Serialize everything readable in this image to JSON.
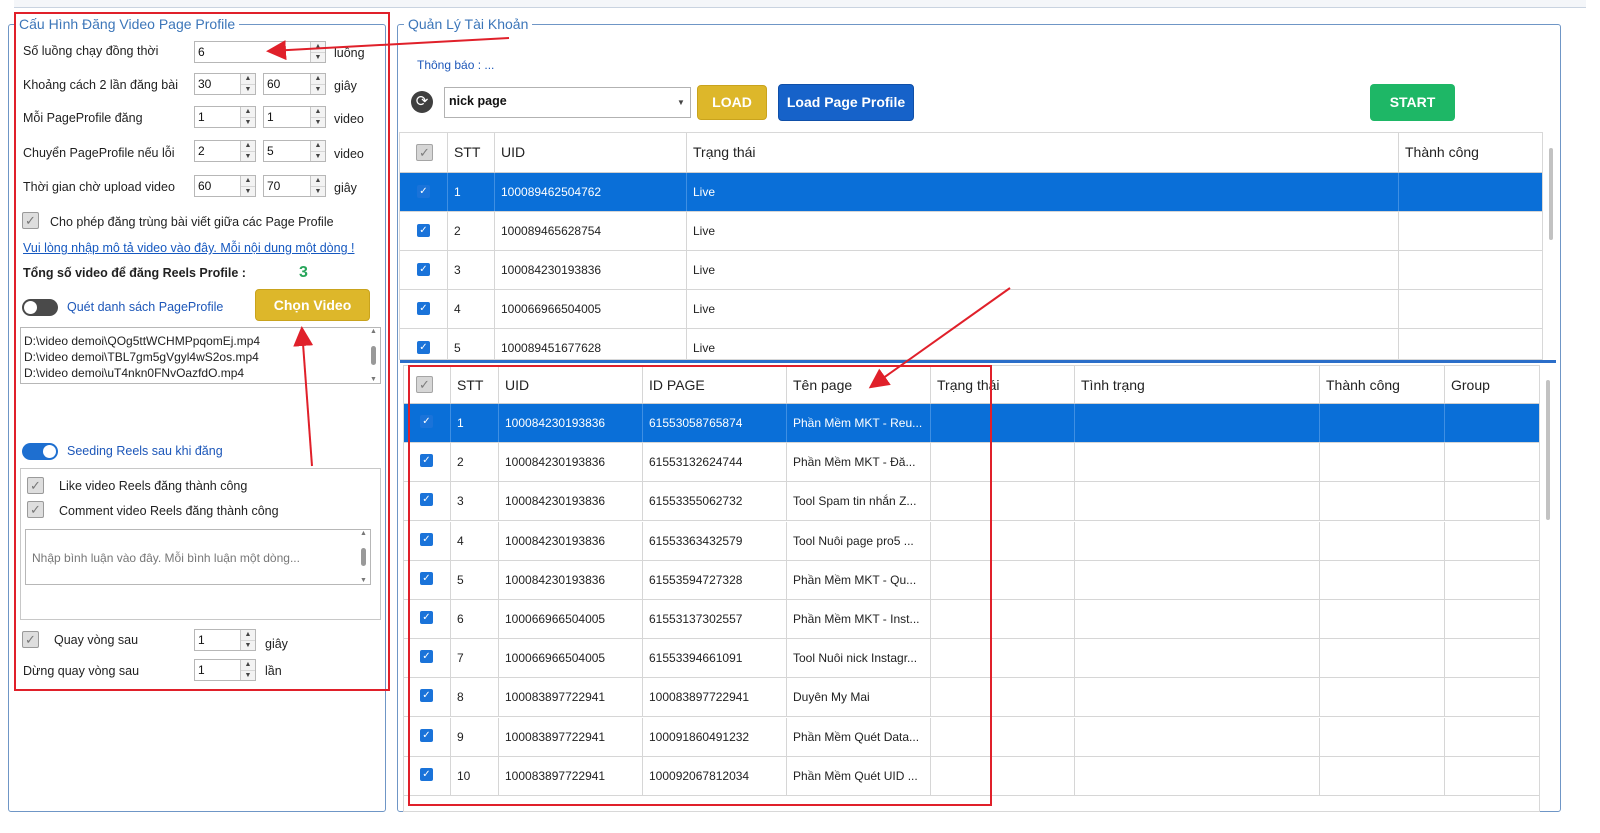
{
  "config": {
    "title": "Cấu Hình Đăng Video Page Profile",
    "threads": {
      "label": "Số luồng chạy đồng thời",
      "value": "6",
      "unit": "luồng"
    },
    "post_gap": {
      "label": "Khoảng cách 2 lần đăng bài",
      "min": "30",
      "max": "60",
      "unit": "giây"
    },
    "per_profile": {
      "label": "Mỗi PageProfile đăng",
      "min": "1",
      "max": "1",
      "unit": "video"
    },
    "switch_on_error": {
      "label": "Chuyển PageProfile nếu lỗi",
      "min": "2",
      "max": "5",
      "unit": "video"
    },
    "upload_wait": {
      "label": "Thời gian chờ upload video",
      "min": "60",
      "max": "70",
      "unit": "giây"
    },
    "allow_duplicate_label": "Cho phép đăng trùng bài viết giữa các Page Profile",
    "description_link": "Vui lòng nhập mô tả video vào đây. Mỗi nội dung một dòng !",
    "total_label": "Tổng số video để đăng Reels Profile :",
    "total_count": "3",
    "scan_toggle_label": "Quét danh sách PageProfile",
    "choose_video_button": "Chọn Video",
    "video_files": [
      "D:\\video demoi\\QOg5ttWCHMPpqomEj.mp4",
      "D:\\video demoi\\TBL7gm5gVgyl4wS2os.mp4",
      "D:\\video demoi\\uT4nkn0FNvOazfdO.mp4"
    ],
    "seeding_toggle_label": "Seeding Reels sau khi đăng",
    "like_label": "Like video Reels đăng thành công",
    "comment_label": "Comment video Reels đăng thành công",
    "comment_placeholder": "Nhập bình luận vào đây. Mỗi bình luận một dòng...",
    "loop_after": {
      "label": "Quay vòng sau",
      "value": "1",
      "unit": "giây"
    },
    "stop_loop_after": {
      "label": "Dừng quay vòng sau",
      "value": "1",
      "unit": "lần"
    }
  },
  "account": {
    "title": "Quản Lý Tài Khoản",
    "notice": "Thông báo : ...",
    "combo_value": "nick page",
    "load_button": "LOAD",
    "load_page_button": "Load Page Profile",
    "start_button": "START"
  },
  "accounts_table": {
    "headers": [
      "STT",
      "UID",
      "Trạng thái",
      "Thành công"
    ],
    "rows": [
      {
        "stt": "1",
        "uid": "100089462504762",
        "status": "Live",
        "success": ""
      },
      {
        "stt": "2",
        "uid": "100089465628754",
        "status": "Live",
        "success": ""
      },
      {
        "stt": "3",
        "uid": "100084230193836",
        "status": "Live",
        "success": ""
      },
      {
        "stt": "4",
        "uid": "100066966504005",
        "status": "Live",
        "success": ""
      },
      {
        "stt": "5",
        "uid": "100089451677628",
        "status": "Live",
        "success": ""
      }
    ]
  },
  "pages_table": {
    "headers": [
      "STT",
      "UID",
      "ID PAGE",
      "Tên page",
      "Trạng thái",
      "Tình trạng",
      "Thành công",
      "Group"
    ],
    "rows": [
      {
        "stt": "1",
        "uid": "100084230193836",
        "page_id": "61553058765874",
        "name": "Phần Mềm MKT - Reu..."
      },
      {
        "stt": "2",
        "uid": "100084230193836",
        "page_id": "61553132624744",
        "name": "Phần Mềm MKT - Đă..."
      },
      {
        "stt": "3",
        "uid": "100084230193836",
        "page_id": "61553355062732",
        "name": "Tool Spam tin nhắn Z..."
      },
      {
        "stt": "4",
        "uid": "100084230193836",
        "page_id": "61553363432579",
        "name": "Tool Nuôi page pro5 ..."
      },
      {
        "stt": "5",
        "uid": "100084230193836",
        "page_id": "61553594727328",
        "name": "Phần Mềm MKT - Qu..."
      },
      {
        "stt": "6",
        "uid": "100066966504005",
        "page_id": "61553137302557",
        "name": "Phần Mềm MKT - Inst..."
      },
      {
        "stt": "7",
        "uid": "100066966504005",
        "page_id": "61553394661091",
        "name": "Tool Nuôi nick Instagr..."
      },
      {
        "stt": "8",
        "uid": "100083897722941",
        "page_id": "100083897722941",
        "name": "Duyên My Mai"
      },
      {
        "stt": "9",
        "uid": "100083897722941",
        "page_id": "100091860491232",
        "name": "Phần Mềm Quét Data..."
      },
      {
        "stt": "10",
        "uid": "100083897722941",
        "page_id": "100092067812034",
        "name": "Phần Mềm Quét UID ..."
      }
    ]
  },
  "colors": {
    "accent": "#0a6fd8",
    "load": "#ddb72a",
    "start": "#1eb766",
    "annotation": "#e0202a"
  }
}
